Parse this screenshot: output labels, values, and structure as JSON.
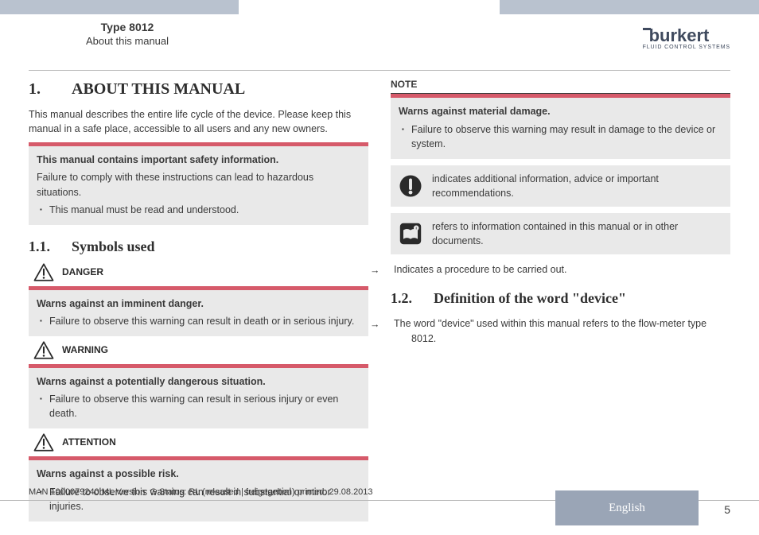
{
  "header": {
    "type": "Type 8012",
    "subtitle": "About this manual",
    "brand_name": "burkert",
    "brand_tag": "FLUID CONTROL SYSTEMS"
  },
  "left": {
    "h1_num": "1.",
    "h1_title": "ABOUT THIS MANUAL",
    "intro": "This manual describes the entire life cycle of the device. Please keep this manual in a safe place, accessible to all users and any new owners.",
    "safety_box": {
      "title": "This manual contains important safety information.",
      "line": "Failure to comply with these instructions can lead to hazardous situations.",
      "bullet": "This manual must be read and understood."
    },
    "h2_num": "1.1.",
    "h2_title": "Symbols used",
    "danger": {
      "label": "DANGER",
      "title": "Warns against an imminent danger.",
      "bullet": "Failure to observe this warning can result in death or in serious injury."
    },
    "warning": {
      "label": "WARNING",
      "title": "Warns against a potentially dangerous situation.",
      "bullet": "Failure to observe this warning can result in serious injury or even death."
    },
    "attention": {
      "label": "ATTENTION",
      "title": "Warns against a possible risk.",
      "bullet": "Failure to observe this warning can result in substantial or minor injuries."
    }
  },
  "right": {
    "note_label": "NOTE",
    "note_box": {
      "title": "Warns against material damage.",
      "bullet": "Failure to observe this warning may result in damage to the device or system."
    },
    "info1": "indicates additional information, advice or important recommendations.",
    "info2": "refers to information contained in this manual or in other documents.",
    "arrow1": "Indicates a procedure to be carried out.",
    "h2_num": "1.2.",
    "h2_title": "Definition of the word \"device\"",
    "arrow2": "The word \"device\" used within this manual refers to the flow-meter type 8012."
  },
  "footer": {
    "meta": "MAN 1000079240 ML Version: G Status: RL (released | freigegeben) printed: 29.08.2013",
    "lang": "English",
    "page": "5"
  }
}
